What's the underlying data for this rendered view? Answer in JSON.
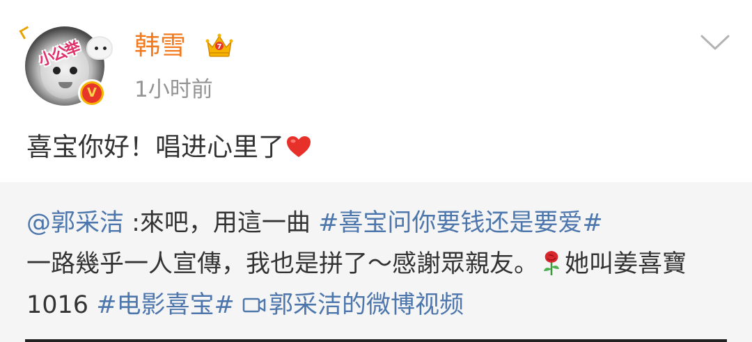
{
  "post": {
    "author": {
      "name": "韩雪",
      "avatar_sticker_text": "小公举",
      "verified_badge": "V",
      "crown_icon": "crown-icon"
    },
    "time": "1小时前",
    "menu_icon": "chevron-down-icon",
    "content": {
      "text": "喜宝你好！唱进心里了",
      "emoji": "heart-icon"
    }
  },
  "repost": {
    "mention": "@郭采洁",
    "text_1": " :來吧，用這一曲 ",
    "topic_1": "#喜宝问你要钱还是要爱#",
    "text_2": "一路幾乎一人宣傳，我也是拼了～感謝眾親友。",
    "emoji": "rose-icon",
    "text_3": "她叫姜喜寶 1016 ",
    "topic_2": "#电影喜宝#",
    "video_link": "郭采洁的微博视频",
    "video_icon": "video-icon"
  },
  "colors": {
    "username": "#f3791d",
    "link": "#4d76ac",
    "time": "#939393",
    "text": "#333333",
    "repost_bg": "#f5f5f5"
  }
}
